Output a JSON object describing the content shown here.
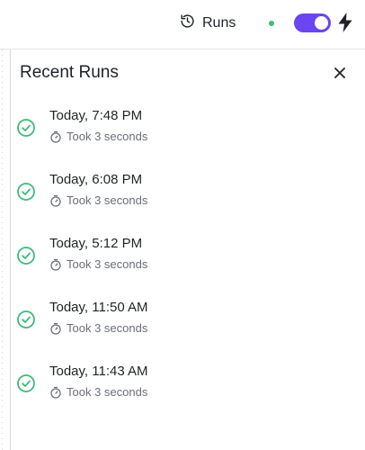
{
  "header": {
    "runs_label": "Runs",
    "status_color": "#3dbb79",
    "toggle_on": true,
    "toggle_color": "#6a45f0",
    "icons": {
      "runs": "history-icon",
      "bolt": "lightning-bolt-icon"
    }
  },
  "panel": {
    "title": "Recent Runs",
    "close_icon": "close-icon"
  },
  "runs": [
    {
      "when": "Today, 7:48 PM",
      "duration": "Took 3 seconds",
      "status": "success"
    },
    {
      "when": "Today, 6:08 PM",
      "duration": "Took 3 seconds",
      "status": "success"
    },
    {
      "when": "Today, 5:12 PM",
      "duration": "Took 3 seconds",
      "status": "success"
    },
    {
      "when": "Today, 11:50 AM",
      "duration": "Took 3 seconds",
      "status": "success"
    },
    {
      "when": "Today, 11:43 AM",
      "duration": "Took 3 seconds",
      "status": "success"
    }
  ],
  "colors": {
    "success": "#3dbb79",
    "muted_text": "#6b6f76"
  }
}
